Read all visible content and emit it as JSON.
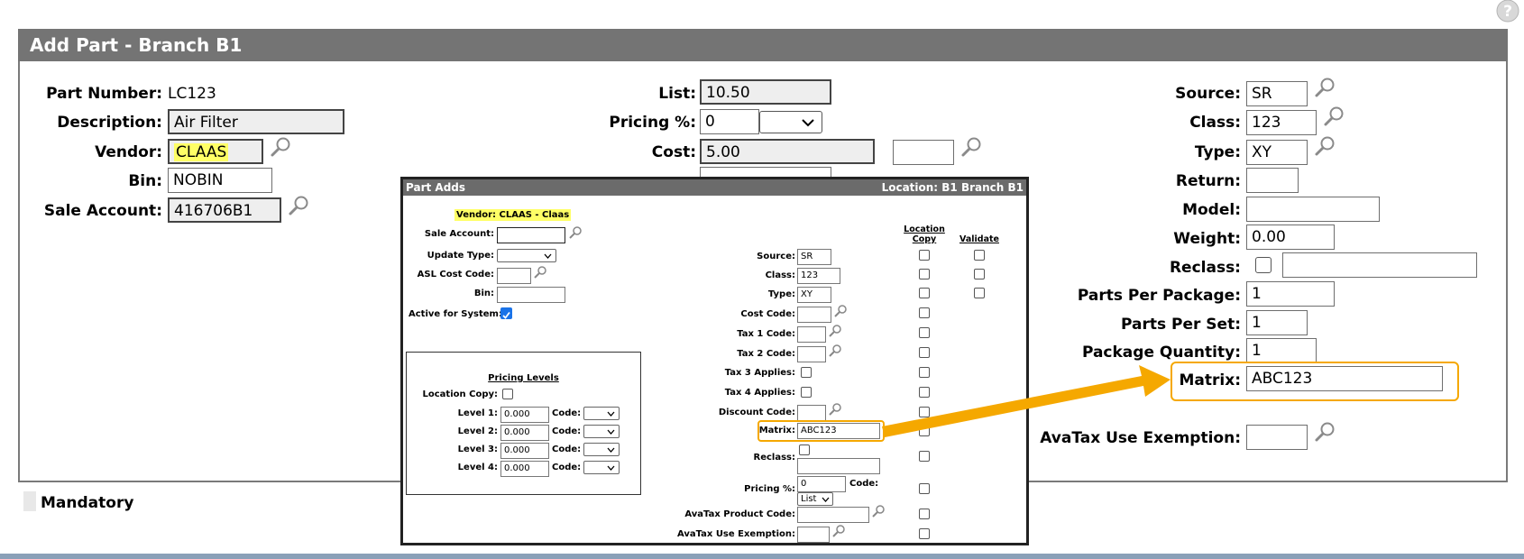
{
  "window": {
    "title": "Add Part -  Branch B1",
    "help_icon": "question-circle-icon"
  },
  "form": {
    "left": {
      "part_number_label": "Part Number:",
      "part_number_value": "LC123",
      "description_label": "Description:",
      "description_value": "Air Filter",
      "vendor_label": "Vendor:",
      "vendor_value": "CLAAS",
      "bin_label": "Bin:",
      "bin_value": "NOBIN",
      "sale_account_label": "Sale Account:",
      "sale_account_value": "416706B1"
    },
    "middle": {
      "list_label": "List:",
      "list_value": "10.50",
      "pricing_label": "Pricing %:",
      "pricing_value": "0",
      "cost_label": "Cost:",
      "cost_value": "5.00"
    },
    "right": {
      "source_label": "Source:",
      "source_value": "SR",
      "class_label": "Class:",
      "class_value": "123",
      "type_label": "Type:",
      "type_value": "XY",
      "return_label": "Return:",
      "return_value": "",
      "model_label": "Model:",
      "model_value": "",
      "weight_label": "Weight:",
      "weight_value": "0.00",
      "reclass_label": "Reclass:",
      "reclass_value": "",
      "ppp_label": "Parts Per Package:",
      "ppp_value": "1",
      "pps_label": "Parts Per Set:",
      "pps_value": "1",
      "pq_label": "Package Quantity:",
      "pq_value": "1",
      "matrix_label": "Matrix:",
      "matrix_value": "ABC123",
      "avatax_label": "AvaTax Use Exemption:",
      "avatax_value": ""
    },
    "mandatory_label": "Mandatory"
  },
  "popup": {
    "title": "Part Adds",
    "location": "Location:  B1 Branch B1",
    "vendor_text": "Vendor: CLAAS - Claas",
    "sale_account_label": "Sale Account:",
    "update_type_label": "Update Type:",
    "asl_label": "ASL Cost Code:",
    "bin_label": "Bin:",
    "active_label": "Active for System:",
    "pricing_levels_title": "Pricing Levels",
    "location_copy_label": "Location Copy:",
    "levels": [
      {
        "label": "Level 1:",
        "value": "0.000",
        "code_label": "Code:"
      },
      {
        "label": "Level 2:",
        "value": "0.000",
        "code_label": "Code:"
      },
      {
        "label": "Level 3:",
        "value": "0.000",
        "code_label": "Code:"
      },
      {
        "label": "Level 4:",
        "value": "0.000",
        "code_label": "Code:"
      }
    ],
    "col_location_copy": "Location\nCopy",
    "col_validate": "Validate",
    "source_label": "Source:",
    "source_value": "SR",
    "class_label": "Class:",
    "class_value": "123",
    "type_label": "Type:",
    "type_value": "XY",
    "cost_code_label": "Cost Code:",
    "tax1_label": "Tax 1 Code:",
    "tax2_label": "Tax 2 Code:",
    "tax3_label": "Tax 3 Applies:",
    "tax4_label": "Tax 4 Applies:",
    "discount_label": "Discount Code:",
    "matrix_label": "Matrix:",
    "matrix_value": "ABC123",
    "reclass_label": "Reclass:",
    "pricing_label": "Pricing %:",
    "pricing_value": "0",
    "pricing_code_label": "Code:",
    "pricing_select": "List",
    "avatax_product_label": "AvaTax Product Code:",
    "avatax_use_label": "AvaTax Use Exemption:"
  },
  "colors": {
    "header": "#747474",
    "highlight": "#ffff66",
    "callout": "#f5a800",
    "checkbox_checked": "#1a73e8"
  }
}
